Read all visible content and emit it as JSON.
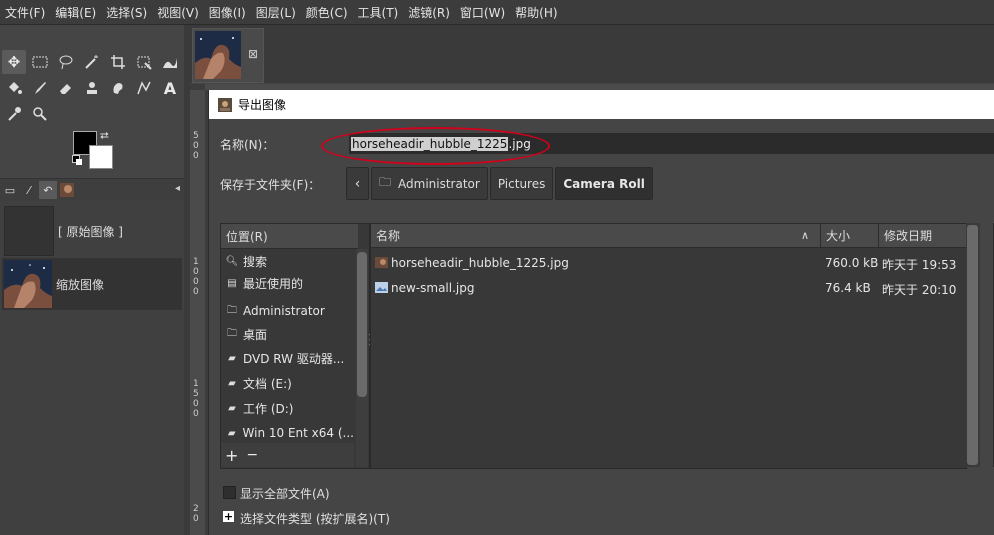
{
  "menubar": {
    "items": [
      "文件(F)",
      "编辑(E)",
      "选择(S)",
      "视图(V)",
      "图像(I)",
      "图层(L)",
      "颜色(C)",
      "工具(T)",
      "滤镜(R)",
      "窗口(W)",
      "帮助(H)"
    ]
  },
  "toolbox": {
    "tools_row1": [
      "move-tool",
      "rect-select-tool",
      "free-select-tool",
      "fuzzy-select-tool",
      "crop-tool",
      "unified-transform-tool",
      "warp-transform-tool"
    ],
    "tools_row2": [
      "bucket-fill-tool",
      "paintbrush-tool",
      "eraser-tool",
      "clone-tool",
      "smudge-tool",
      "paths-tool",
      "text-tool"
    ],
    "tools_row3": [
      "color-picker-tool",
      "zoom-tool"
    ],
    "fg_color": "#000000",
    "bg_color": "#ffffff"
  },
  "layers": {
    "items": [
      {
        "label": "[ 原始图像 ]"
      },
      {
        "label": "缩放图像"
      }
    ]
  },
  "rulers": {
    "left_numbers": [
      "5",
      "0",
      "0",
      "1",
      "0",
      "0",
      "0",
      "1",
      "5",
      "0",
      "0",
      "2",
      "0"
    ]
  },
  "dialog": {
    "title": "导出图像",
    "name_label": "名称(N)：",
    "filename_selected": "horseheadir_hubble_1225",
    "filename_ext": ".jpg",
    "folder_label": "保存于文件夹(F)：",
    "path": [
      "Administrator",
      "Pictures",
      "Camera Roll"
    ],
    "places_header": "位置(R)",
    "places": [
      {
        "label": "搜索",
        "icon": "search-icon"
      },
      {
        "label": "最近使用的",
        "icon": "recent-icon"
      },
      {
        "label": "Administrator",
        "icon": "folder-icon"
      },
      {
        "label": "桌面",
        "icon": "folder-icon"
      },
      {
        "label": "DVD RW 驱动器...",
        "icon": "drive-icon"
      },
      {
        "label": "文档 (E:)",
        "icon": "drive-icon"
      },
      {
        "label": "工作 (D:)",
        "icon": "drive-icon"
      },
      {
        "label": "Win 10 Ent x64 (...",
        "icon": "drive-icon"
      }
    ],
    "columns": {
      "name": "名称",
      "size": "大小",
      "modified": "修改日期"
    },
    "files": [
      {
        "name": "horseheadir_hubble_1225.jpg",
        "size": "760.0 kB",
        "modified": "昨天于 19:53"
      },
      {
        "name": "new-small.jpg",
        "size": "76.4 kB",
        "modified": "昨天于 20:10"
      }
    ],
    "show_all_files": "显示全部文件(A)",
    "select_type": "选择文件类型 (按扩展名)(T)"
  }
}
